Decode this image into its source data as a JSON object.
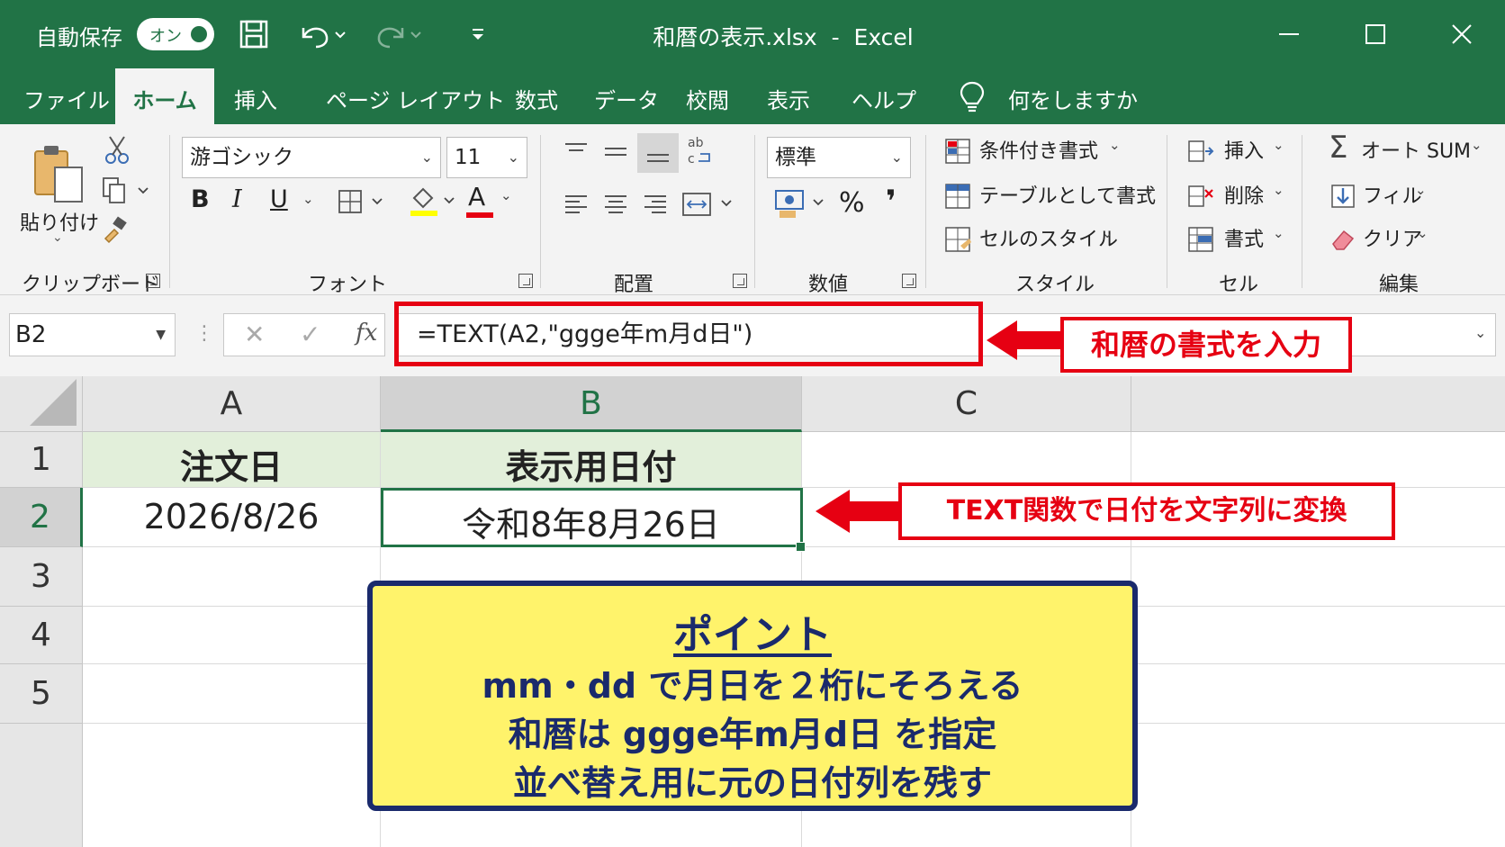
{
  "titlebar": {
    "autosave_label": "自動保存",
    "autosave_state": "オン",
    "title": "和暦の表示.xlsx  -  Excel"
  },
  "tabs": [
    "ファイル",
    "ホーム",
    "挿入",
    "ページ レイアウト",
    "数式",
    "データ",
    "校閲",
    "表示",
    "ヘルプ"
  ],
  "active_tab": "ホーム",
  "tell_me": "何をしますか",
  "ribbon": {
    "clipboard": {
      "paste": "貼り付け",
      "group": "クリップボード"
    },
    "font": {
      "name": "游ゴシック",
      "size": "11",
      "bold": "B",
      "italic": "I",
      "underline": "U",
      "font_color_letter": "A",
      "group": "フォント"
    },
    "alignment": {
      "group": "配置"
    },
    "number": {
      "format": "標準",
      "percent": "%",
      "comma": "❜",
      "group": "数値"
    },
    "styles": {
      "conditional": "条件付き書式",
      "table": "テーブルとして書式",
      "cell_styles": "セルのスタイル",
      "group": "スタイル"
    },
    "cells": {
      "insert": "挿入",
      "delete": "削除",
      "format": "書式",
      "group": "セル"
    },
    "editing": {
      "autosum": "オート SUM",
      "fill": "フィル",
      "clear": "クリア",
      "group": "編集"
    }
  },
  "formula_bar": {
    "name_box": "B2",
    "fx": "fx",
    "formula": "=TEXT(A2,\"ggge年m月d日\")"
  },
  "grid": {
    "columns": [
      "A",
      "B",
      "C"
    ],
    "rows": [
      "1",
      "2",
      "3",
      "4",
      "5"
    ],
    "cells": {
      "A1": "注文日",
      "B1": "表示用日付",
      "A2": "2026/8/26",
      "B2": "令和8年8月26日"
    }
  },
  "callouts": {
    "formula": "和暦の書式を入力",
    "cell": "TEXT関数で日付を文字列に変換"
  },
  "point": {
    "title": "ポイント",
    "lines": [
      "mm・dd で月日を２桁にそろえる",
      "和暦は ggge年m月d日 を指定",
      "並べ替え用に元の日付列を残す"
    ]
  },
  "colors": {
    "excel_green": "#217346",
    "callout_red": "#e60012",
    "point_bg": "#fff36b",
    "point_border": "#1a2a6c",
    "header_fill": "#e2efda"
  }
}
